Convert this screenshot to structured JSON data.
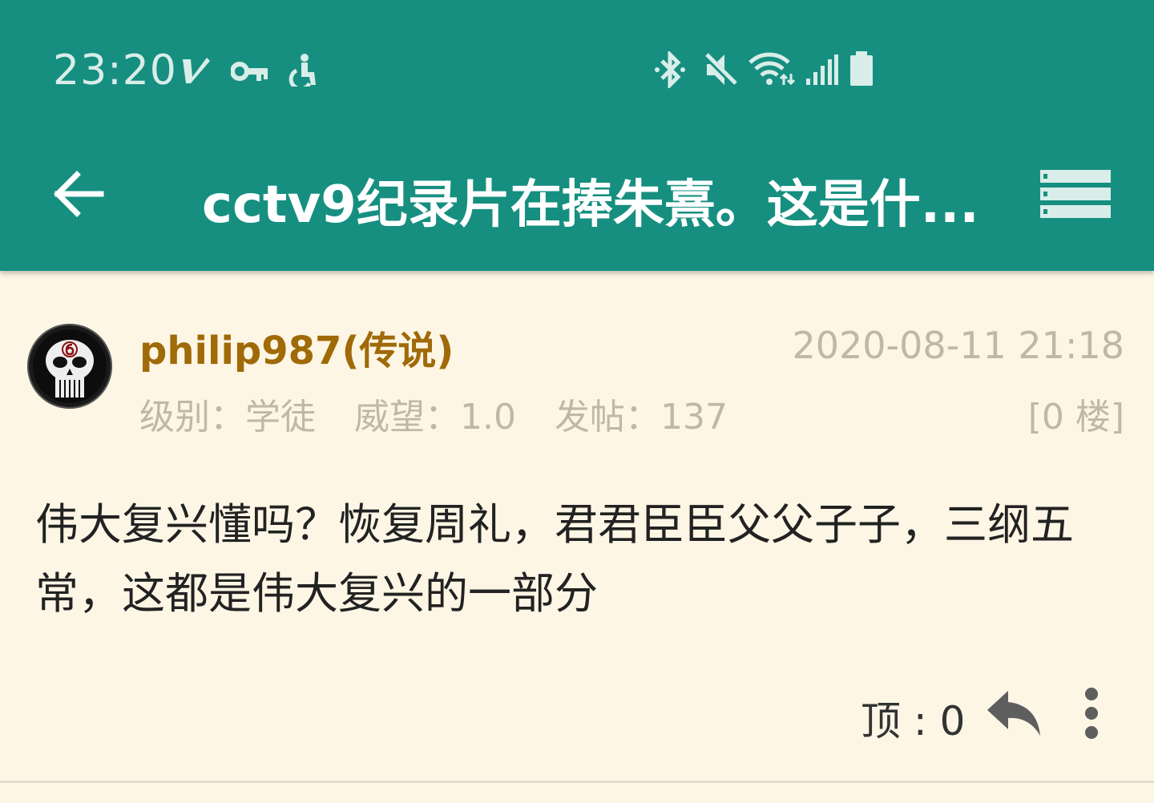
{
  "status_bar": {
    "time": "23:20",
    "left_icons": [
      "nav-arrow-icon",
      "key-icon",
      "accessibility-icon"
    ],
    "right_icons": [
      "bluetooth-icon",
      "mute-icon",
      "wifi-icon",
      "signal-icon",
      "battery-icon"
    ]
  },
  "toolbar": {
    "back_icon": "back-arrow-icon",
    "title": "cctv9纪录片在捧朱熹。这是什...",
    "menu_icon": "list-menu-icon"
  },
  "post": {
    "username": "philip987(传说)",
    "timestamp": "2020-08-11 21:18",
    "level": "级别：学徒",
    "prestige": "威望：1.0",
    "posts": "发帖：137",
    "floor": "[0 楼]",
    "content": "伟大复兴懂吗？恢复周礼，君君臣臣父父子子，三纲五常，这都是伟大复兴的一部分",
    "likes_label": "顶 : 0"
  },
  "colors": {
    "header": "#168f80",
    "background": "#fdf6e5",
    "username": "#a06a08",
    "meta": "#bfb8a7"
  }
}
